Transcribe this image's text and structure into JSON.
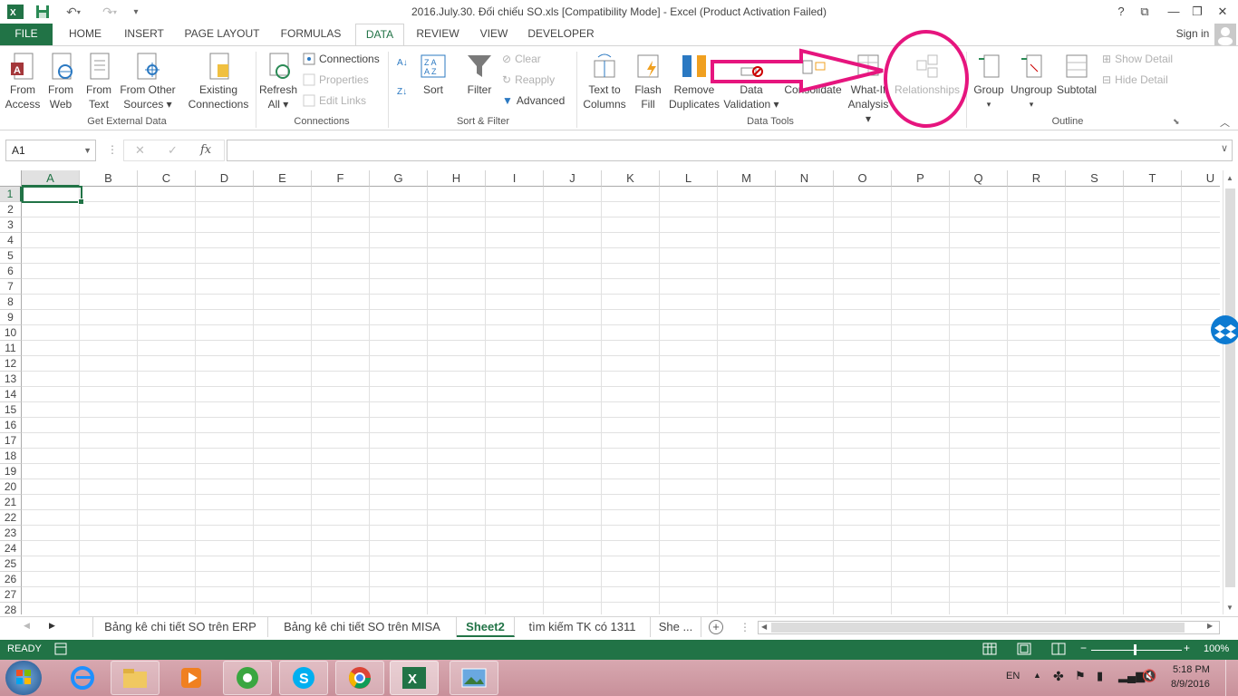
{
  "window": {
    "title": "2016.July.30. Đối chiếu SO.xls  [Compatibility Mode] - Excel (Product Activation Failed)",
    "help": "?",
    "signin": "Sign in"
  },
  "tabs": [
    "FILE",
    "HOME",
    "INSERT",
    "PAGE LAYOUT",
    "FORMULAS",
    "DATA",
    "REVIEW",
    "VIEW",
    "DEVELOPER"
  ],
  "active_tab": "DATA",
  "ribbon": {
    "get_external_data": {
      "name": "Get External Data",
      "from_access": [
        "From",
        "Access"
      ],
      "from_web": [
        "From",
        "Web"
      ],
      "from_text": [
        "From",
        "Text"
      ],
      "from_other": [
        "From Other",
        "Sources ▾"
      ],
      "existing": [
        "Existing",
        "Connections"
      ]
    },
    "connections": {
      "name": "Connections",
      "refresh": [
        "Refresh",
        "All ▾"
      ],
      "connections": "Connections",
      "properties": "Properties",
      "edit_links": "Edit Links"
    },
    "sort_filter": {
      "name": "Sort & Filter",
      "sort": "Sort",
      "filter": "Filter",
      "clear": "Clear",
      "reapply": "Reapply",
      "advanced": "Advanced"
    },
    "data_tools": {
      "name": "Data Tools",
      "text_to_columns": [
        "Text to",
        "Columns"
      ],
      "flash_fill": [
        "Flash",
        "Fill"
      ],
      "remove_duplicates": [
        "Remove",
        "Duplicates"
      ],
      "data_validation": [
        "Data",
        "Validation ▾"
      ],
      "consolidate": "Consolidate",
      "what_if": [
        "What-If",
        "Analysis ▾"
      ],
      "relationships": "Relationships"
    },
    "outline": {
      "name": "Outline",
      "group": [
        "Group",
        "▾"
      ],
      "ungroup": [
        "Ungroup",
        "▾"
      ],
      "subtotal": "Subtotal",
      "show_detail": "Show Detail",
      "hide_detail": "Hide Detail"
    }
  },
  "formula_bar": {
    "name_box": "A1",
    "fx": "fx",
    "value": ""
  },
  "columns": [
    "A",
    "B",
    "C",
    "D",
    "E",
    "F",
    "G",
    "H",
    "I",
    "J",
    "K",
    "L",
    "M",
    "N",
    "O",
    "P",
    "Q",
    "R",
    "S",
    "T",
    "U"
  ],
  "rows": [
    "1",
    "2",
    "3",
    "4",
    "5",
    "6",
    "7",
    "8",
    "9",
    "10",
    "11",
    "12",
    "13",
    "14",
    "15",
    "16",
    "17",
    "18",
    "19",
    "20",
    "21",
    "22",
    "23",
    "24",
    "25",
    "26",
    "27",
    "28"
  ],
  "selected_cell": "A1",
  "sheets": [
    "Bảng kê chi tiết SO trên ERP",
    "Bảng kê chi tiết SO trên MISA",
    "Sheet2",
    "tìm kiếm TK có 1311",
    "She ..."
  ],
  "active_sheet": "Sheet2",
  "status": {
    "ready": "READY",
    "zoom": "100%"
  },
  "taskbar": {
    "lang": "EN",
    "time": "5:18 PM",
    "date": "8/9/2016"
  },
  "colors": {
    "excel_green": "#217346",
    "annotation": "#e6157e"
  }
}
